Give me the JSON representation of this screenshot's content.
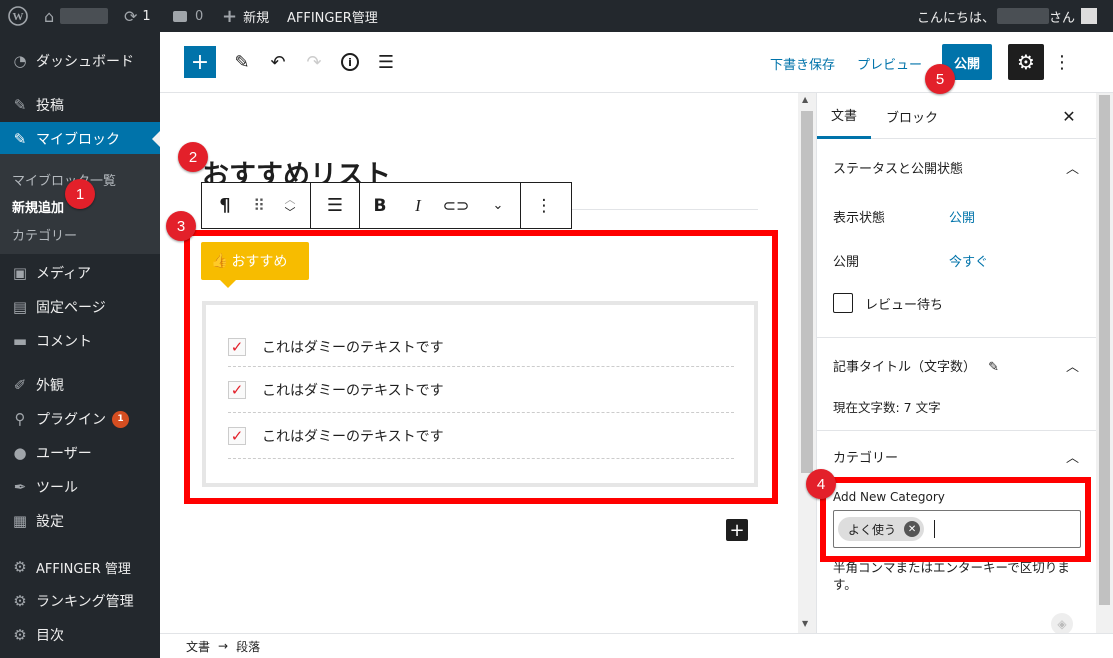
{
  "admin_bar": {
    "comments_count": "0",
    "updates_count": "1",
    "new_label": "新規",
    "affinger_label": "AFFINGER管理",
    "greeting_prefix": "こんにちは、",
    "greeting_suffix": "さん"
  },
  "sidebar": {
    "items": [
      {
        "label": "ダッシュボード",
        "icon": "dashboard-icon"
      },
      {
        "label": "投稿",
        "icon": "pin-icon"
      },
      {
        "label": "マイブロック",
        "icon": "pin-icon"
      },
      {
        "label": "メディア",
        "icon": "media-icon"
      },
      {
        "label": "固定ページ",
        "icon": "page-icon"
      },
      {
        "label": "コメント",
        "icon": "comment-icon"
      },
      {
        "label": "外観",
        "icon": "appearance-icon"
      },
      {
        "label": "プラグイン",
        "icon": "plugin-icon",
        "badge": "1"
      },
      {
        "label": "ユーザー",
        "icon": "user-icon"
      },
      {
        "label": "ツール",
        "icon": "wrench-icon"
      },
      {
        "label": "設定",
        "icon": "settings-icon"
      },
      {
        "label": "AFFINGER 管理",
        "icon": "gear-icon"
      },
      {
        "label": "ランキング管理",
        "icon": "gear-icon"
      },
      {
        "label": "目次",
        "icon": "gear-icon"
      }
    ],
    "submenu": [
      "マイブロック一覧",
      "新規追加",
      "カテゴリー"
    ]
  },
  "toolbar": {
    "save_draft": "下書き保存",
    "preview": "プレビュー",
    "publish": "公開"
  },
  "editor": {
    "title": "おすすめリスト",
    "label_badge": "おすすめ",
    "list_items": [
      "これはダミーのテキストです",
      "これはダミーのテキストです",
      "これはダミーのテキストです"
    ]
  },
  "settings": {
    "tabs": [
      "文書",
      "ブロック"
    ],
    "status_panel": "ステータスと公開状態",
    "visibility_label": "表示状態",
    "visibility_value": "公開",
    "publish_label": "公開",
    "publish_value": "今すぐ",
    "pending_review": "レビュー待ち",
    "title_panel": "記事タイトル（文字数）",
    "char_count": "現在文字数: 7 文字",
    "category_panel": "カテゴリー",
    "add_new_category": "Add New Category",
    "tag_token": "よく使う",
    "help_text": "半角コンマまたはエンターキーで区切ります。"
  },
  "footer": {
    "breadcrumb_root": "文書",
    "breadcrumb_arrow": "→",
    "breadcrumb_current": "段落"
  },
  "markers": [
    "1",
    "2",
    "3",
    "4",
    "5"
  ],
  "colors": {
    "admin_bg": "#23282d",
    "accent": "#0073aa",
    "highlight": "#ff0000",
    "badge_yellow": "#f7bc00",
    "marker_red": "#e3202a"
  }
}
